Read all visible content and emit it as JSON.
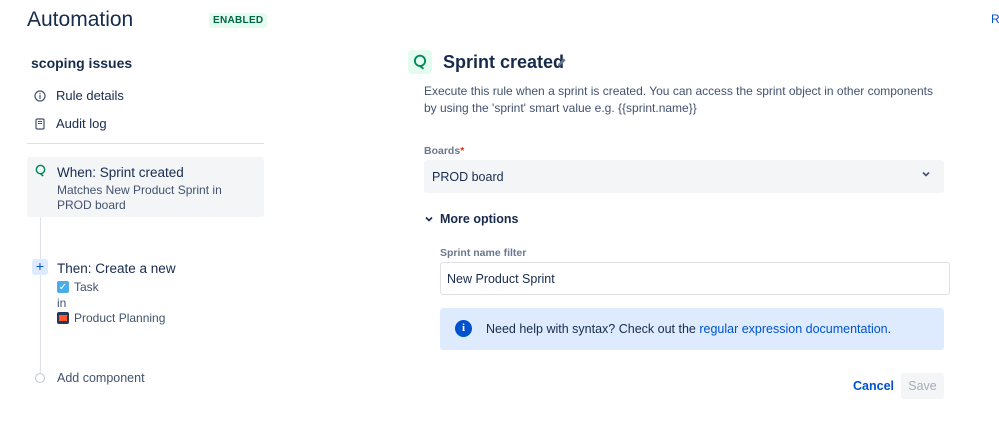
{
  "header": {
    "title": "Automation",
    "status_badge": "ENABLED",
    "right_link": "R"
  },
  "sidebar": {
    "rule_name": "scoping issues",
    "nav": [
      {
        "label": "Rule details",
        "icon": "info-icon"
      },
      {
        "label": "Audit log",
        "icon": "audit-log-icon"
      }
    ],
    "trigger": {
      "title": "When: Sprint created",
      "description": "Matches New Product Sprint in PROD board"
    },
    "action": {
      "title": "Then: Create a new",
      "issue_type": "Task",
      "connector": "in",
      "project": "Product Planning"
    },
    "add_component": "Add component"
  },
  "panel": {
    "title": "Sprint created",
    "description": "Execute this rule when a sprint is created. You can access the sprint object in other components by using the 'sprint' smart value e.g. {{sprint.name}}",
    "boards_label": "Boards",
    "boards_required": "*",
    "boards_value": "PROD board",
    "more_options": "More options",
    "sprint_filter_label": "Sprint name filter",
    "sprint_filter_value": "New Product Sprint",
    "info_text": "Need help with syntax? Check out the ",
    "info_link": "regular expression documentation",
    "info_suffix": ".",
    "cancel_label": "Cancel",
    "save_label": "Save"
  }
}
